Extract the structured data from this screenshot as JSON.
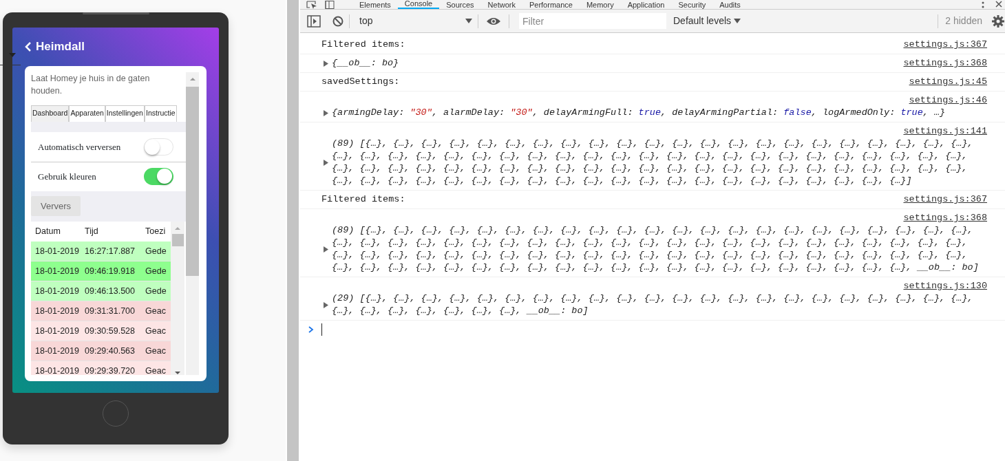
{
  "phone": {
    "header": {
      "title": "Heimdall"
    },
    "description": "Laat Homey je huis in de gaten houden.",
    "tabs": [
      {
        "label": "Dashboard",
        "selected": true
      },
      {
        "label": "Apparaten",
        "selected": false
      },
      {
        "label": "Instellingen",
        "selected": false
      },
      {
        "label": "Instructie",
        "selected": false
      }
    ],
    "settings": [
      {
        "label": "Automatisch verversen",
        "on": false
      },
      {
        "label": "Gebruik kleuren",
        "on": true
      }
    ],
    "refresh_button": "Ververs",
    "log_table": {
      "columns": [
        "Datum",
        "Tijd",
        "Toezi"
      ],
      "rows": [
        {
          "cells": [
            "18-01-2019",
            "16:27:17.887",
            "Gede"
          ],
          "color": "#bfffbf"
        },
        {
          "cells": [
            "18-01-2019",
            "09:46:19.918",
            "Gede"
          ],
          "color": "#8eff8e"
        },
        {
          "cells": [
            "18-01-2019",
            "09:46:13.500",
            "Gede"
          ],
          "color": "#bfffbf"
        },
        {
          "cells": [
            "18-01-2019",
            "09:31:31.700",
            "Geac"
          ],
          "color": "#f8d7d7"
        },
        {
          "cells": [
            "18-01-2019",
            "09:30:59.528",
            "Geac"
          ],
          "color": "#fde5e5"
        },
        {
          "cells": [
            "18-01-2019",
            "09:29:40.563",
            "Geac"
          ],
          "color": "#f8d7d7"
        },
        {
          "cells": [
            "18-01-2019",
            "09:29:39.720",
            "Geac"
          ],
          "color": "#fde5e5"
        }
      ]
    }
  },
  "devtools": {
    "tabs": [
      {
        "label": "Elements",
        "selected": false
      },
      {
        "label": "Console",
        "selected": true
      },
      {
        "label": "Sources",
        "selected": false
      },
      {
        "label": "Network",
        "selected": false
      },
      {
        "label": "Performance",
        "selected": false
      },
      {
        "label": "Memory",
        "selected": false
      },
      {
        "label": "Application",
        "selected": false
      },
      {
        "label": "Security",
        "selected": false
      },
      {
        "label": "Audits",
        "selected": false
      }
    ],
    "toolbar": {
      "context": "top",
      "filter_placeholder": "Filter",
      "levels": "Default levels",
      "hidden_count": "2 hidden"
    },
    "messages": [
      {
        "kind": "text",
        "text": "Filtered items:",
        "source": "settings.js:367",
        "source_above": false,
        "expandable": false
      },
      {
        "kind": "object",
        "parts": [
          {
            "kind": "plain",
            "text": "{__ob__: bo}"
          }
        ],
        "source": "settings.js:368",
        "source_above": false,
        "expandable": true
      },
      {
        "kind": "text",
        "text": "savedSettings:",
        "source": "settings.js:45",
        "source_above": false,
        "expandable": false
      },
      {
        "kind": "object",
        "parts": [
          {
            "kind": "plain",
            "text": "{armingDelay: "
          },
          {
            "kind": "string",
            "text": "\"30\""
          },
          {
            "kind": "plain",
            "text": ", alarmDelay: "
          },
          {
            "kind": "string",
            "text": "\"30\""
          },
          {
            "kind": "plain",
            "text": ", delayArmingFull: "
          },
          {
            "kind": "bool",
            "text": "true"
          },
          {
            "kind": "plain",
            "text": ", delayArmingPartial: "
          },
          {
            "kind": "bool",
            "text": "false"
          },
          {
            "kind": "plain",
            "text": ", logArmedOnly: "
          },
          {
            "kind": "bool",
            "text": "true"
          },
          {
            "kind": "plain",
            "text": ", …}"
          }
        ],
        "source": "settings.js:46",
        "source_above": true,
        "expandable": true
      },
      {
        "kind": "object",
        "parts": [
          {
            "kind": "plain",
            "text": "(89) [{…}, {…}, {…}, {…}, {…}, {…}, {…}, {…}, {…}, {…}, {…}, {…}, {…}, {…}, {…}, {…}, {…}, {…}, {…}, {…}, {…}, {…}, {…}, {…}, {…}, {…}, {…}, {…}, {…}, {…}, {…}, {…}, {…}, {…}, {…}, {…}, {…}, {…}, {…}, {…}, {…}, {…}, {…}, {…}, {…}, {…}, {…}, {…}, {…}, {…}, {…}, {…}, {…}, {…}, {…}, {…}, {…}, {…}, {…}, {…}, {…}, {…}, {…}, {…}, {…}, {…}, {…}, {…}, {…}, {…}, {…}, {…}, {…}, {…}, {…}, {…}, {…}, {…}, {…}, {…}, {…}, {…}, {…}, {…}, {…}, {…}, {…}, {…}, {…}]"
          }
        ],
        "source": "settings.js:141",
        "source_above": true,
        "expandable": true
      },
      {
        "kind": "text",
        "text": "Filtered items:",
        "source": "settings.js:367",
        "source_above": false,
        "expandable": false
      },
      {
        "kind": "object",
        "parts": [
          {
            "kind": "plain",
            "text": "(89) [{…}, {…}, {…}, {…}, {…}, {…}, {…}, {…}, {…}, {…}, {…}, {…}, {…}, {…}, {…}, {…}, {…}, {…}, {…}, {…}, {…}, {…}, {…}, {…}, {…}, {…}, {…}, {…}, {…}, {…}, {…}, {…}, {…}, {…}, {…}, {…}, {…}, {…}, {…}, {…}, {…}, {…}, {…}, {…}, {…}, {…}, {…}, {…}, {…}, {…}, {…}, {…}, {…}, {…}, {…}, {…}, {…}, {…}, {…}, {…}, {…}, {…}, {…}, {…}, {…}, {…}, {…}, {…}, {…}, {…}, {…}, {…}, {…}, {…}, {…}, {…}, {…}, {…}, {…}, {…}, {…}, {…}, {…}, {…}, {…}, {…}, {…}, {…}, {…}, __ob__: bo]"
          }
        ],
        "source": "settings.js:368",
        "source_above": true,
        "expandable": true
      },
      {
        "kind": "object",
        "parts": [
          {
            "kind": "plain",
            "text": "(29) [{…}, {…}, {…}, {…}, {…}, {…}, {…}, {…}, {…}, {…}, {…}, {…}, {…}, {…}, {…}, {…}, {…}, {…}, {…}, {…}, {…}, {…}, {…}, {…}, {…}, {…}, {…}, {…}, {…}, __ob__: bo]"
          }
        ],
        "source": "settings.js:130",
        "source_above": true,
        "expandable": true
      }
    ]
  }
}
